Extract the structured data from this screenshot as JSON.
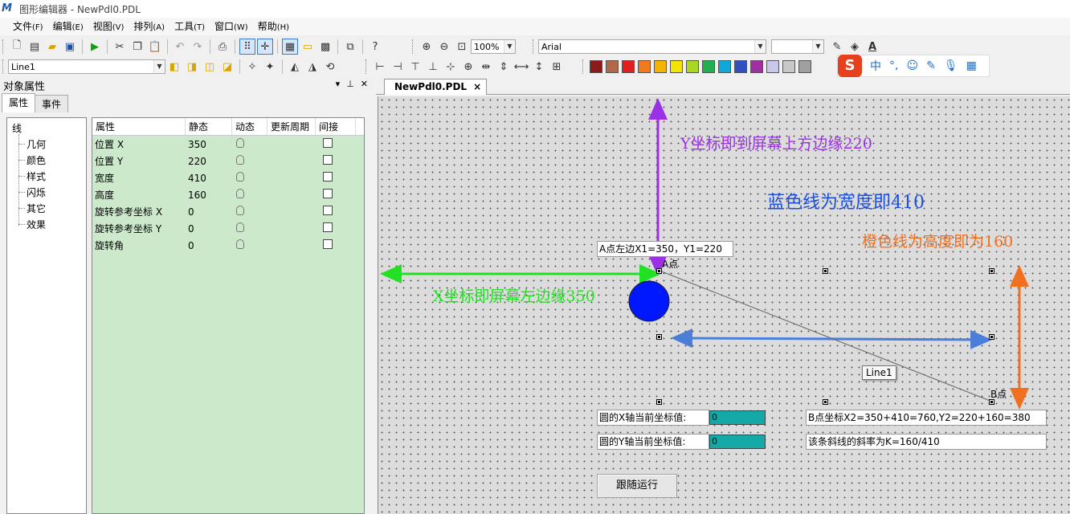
{
  "window": {
    "title": "图形编辑器 - NewPdl0.PDL"
  },
  "menu": [
    {
      "label": "文件",
      "key": "(F)"
    },
    {
      "label": "编辑",
      "key": "(E)"
    },
    {
      "label": "视图",
      "key": "(V)"
    },
    {
      "label": "排列",
      "key": "(A)"
    },
    {
      "label": "工具",
      "key": "(T)"
    },
    {
      "label": "窗口",
      "key": "(W)"
    },
    {
      "label": "帮助",
      "key": "(H)"
    }
  ],
  "toolbar": {
    "zoom_value": "100%",
    "font_name": "Arial",
    "font_size": "",
    "object_select": "Line1"
  },
  "palette_colors": [
    "#8b1a1a",
    "#b06a4a",
    "#e02020",
    "#f07a20",
    "#f5b400",
    "#f5e400",
    "#a8d820",
    "#20b050",
    "#10a8d8",
    "#3050c0",
    "#a030a0",
    "#c8c8e8",
    "#c8c8c8",
    "#a0a0a0"
  ],
  "ime": {
    "lang": "中"
  },
  "left_panel": {
    "title": "对象属性",
    "tabs": [
      "属性",
      "事件"
    ],
    "tree_root": "线",
    "tree_children": [
      "几何",
      "颜色",
      "样式",
      "闪烁",
      "其它",
      "效果"
    ],
    "grid_headers": [
      "属性",
      "静态",
      "动态",
      "更新周期",
      "间接"
    ],
    "rows": [
      {
        "name": "位置 X",
        "value": "350"
      },
      {
        "name": "位置 Y",
        "value": "220"
      },
      {
        "name": "宽度",
        "value": "410"
      },
      {
        "name": "高度",
        "value": "160"
      },
      {
        "name": "旋转参考坐标 X",
        "value": "0"
      },
      {
        "name": "旋转参考坐标 Y",
        "value": "0"
      },
      {
        "name": "旋转角",
        "value": "0"
      }
    ]
  },
  "doc_tab": "NewPdl0.PDL",
  "canvas": {
    "annot_y": "Y坐标即到屏幕上方边缘220",
    "annot_width": "蓝色线为宽度即410",
    "annot_height": "橙色线为高度即为160",
    "annot_x": "X坐标即屏幕左边缘350",
    "point_a_box": "A点左边X1=350，Y1=220",
    "point_a_label": "A点",
    "point_b_label": "B点",
    "line_tooltip": "Line1",
    "circle_x_label": "圆的X轴当前坐标值:",
    "circle_y_label": "圆的Y轴当前坐标值:",
    "circle_x_value": "0",
    "circle_y_value": "0",
    "point_b_box": "B点坐标X2=350+410=760,Y2=220+160=380",
    "slope_box": "该条斜线的斜率为K=160/410",
    "follow_button": "跟随运行"
  },
  "colors": {
    "purple": "#9b30e6",
    "green": "#22e022",
    "blue_text": "#1a4fe0",
    "blue_line": "#4a7ed8",
    "orange": "#f07020",
    "circle": "#0018ff",
    "grid_bg": "#cce9cc",
    "teal": "#14a9a6"
  }
}
